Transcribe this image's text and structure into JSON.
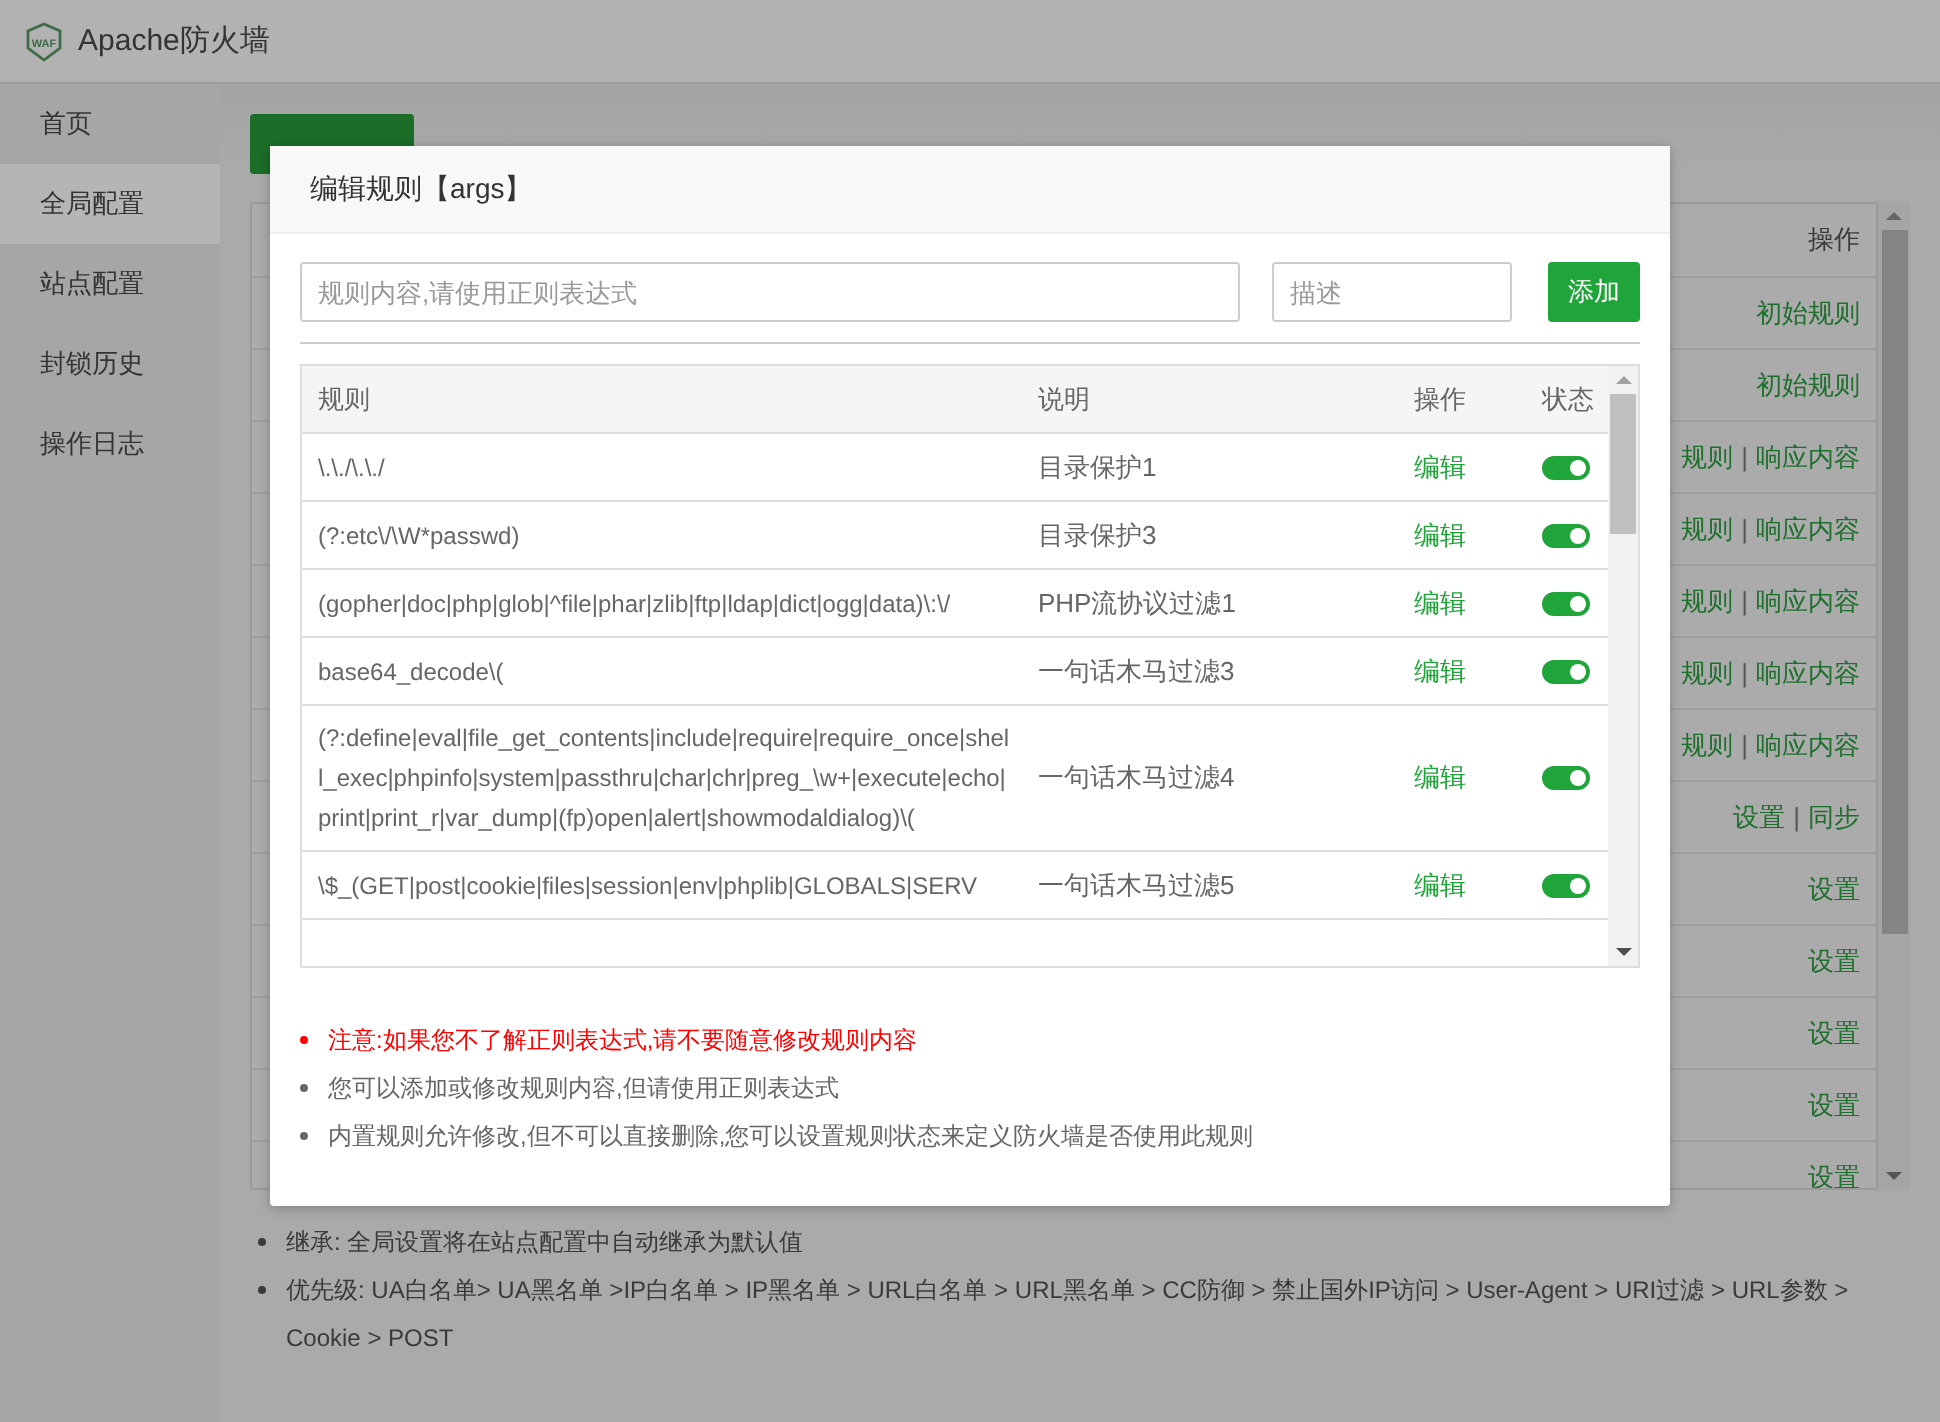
{
  "app": {
    "title": "Apache防火墙",
    "logo_text": "WAF"
  },
  "sidebar": {
    "items": [
      {
        "label": "首页",
        "selected": false
      },
      {
        "label": "全局配置",
        "selected": true
      },
      {
        "label": "站点配置",
        "selected": false
      },
      {
        "label": "封锁历史",
        "selected": false
      },
      {
        "label": "操作日志",
        "selected": false
      }
    ]
  },
  "config_table": {
    "column_heading": "操作",
    "rows": [
      {
        "actions": [
          "初始规则"
        ]
      },
      {
        "actions": [
          "初始规则"
        ]
      },
      {
        "actions": [
          "规则",
          "响应内容"
        ],
        "separator": "|"
      },
      {
        "actions": [
          "规则",
          "响应内容"
        ],
        "separator": "|"
      },
      {
        "actions": [
          "规则",
          "响应内容"
        ],
        "separator": "|"
      },
      {
        "actions": [
          "规则",
          "响应内容"
        ],
        "separator": "|"
      },
      {
        "actions": [
          "规则",
          "响应内容"
        ],
        "separator": "|"
      },
      {
        "actions": [
          "设置",
          "同步"
        ],
        "separator": "|"
      },
      {
        "actions": [
          "设置"
        ]
      },
      {
        "actions": [
          "设置"
        ]
      },
      {
        "actions": [
          "设置"
        ]
      },
      {
        "actions": [
          "设置"
        ]
      },
      {
        "actions": [
          "设置"
        ]
      }
    ]
  },
  "notes": [
    "继承: 全局设置将在站点配置中自动继承为默认值",
    "优先级: UA白名单> UA黑名单 >IP白名单 > IP黑名单 > URL白名单 > URL黑名单 > CC防御 > 禁止国外IP访问 > User-Agent > URI过滤 > URL参数 > Cookie > POST"
  ],
  "dialog": {
    "title": "编辑规则【args】",
    "rule_input": {
      "placeholder": "规则内容,请使用正则表达式"
    },
    "description_input": {
      "placeholder": "描述"
    },
    "add_button": "添加",
    "columns": [
      "规则",
      "说明",
      "操作",
      "状态"
    ],
    "rows": [
      {
        "rule": "\\.\\./\\.\\./",
        "description": "目录保护1",
        "action": "编辑",
        "on": true
      },
      {
        "rule": "(?:etc\\/\\W*passwd)",
        "description": "目录保护3",
        "action": "编辑",
        "on": true
      },
      {
        "rule": "(gopher|doc|php|glob|^file|phar|zlib|ftp|ldap|dict|ogg|data)\\:\\/",
        "description": "PHP流协议过滤1",
        "action": "编辑",
        "on": true
      },
      {
        "rule": "base64_decode\\(",
        "description": "一句话木马过滤3",
        "action": "编辑",
        "on": true
      },
      {
        "rule": "(?:define|eval|file_get_contents|include|require|require_once|shell_exec|phpinfo|system|passthru|char|chr|preg_\\w+|execute|echo|print|print_r|var_dump|(fp)open|alert|showmodaldialog)\\(",
        "description": "一句话木马过滤4",
        "action": "编辑",
        "on": true
      },
      {
        "rule": "\\$_(GET|post|cookie|files|session|env|phplib|GLOBALS|SERV",
        "description": "一句话木马过滤5",
        "action": "编辑",
        "on": true
      }
    ],
    "notes": [
      {
        "text": "注意:如果您不了解正则表达式,请不要随意修改规则内容",
        "kind": "warning"
      },
      {
        "text": "您可以添加或修改规则内容,但请使用正则表达式",
        "kind": "info"
      },
      {
        "text": "内置规则允许修改,但不可以直接删除,您可以设置规则状态来定义防火墙是否使用此规则",
        "kind": "info"
      }
    ]
  }
}
